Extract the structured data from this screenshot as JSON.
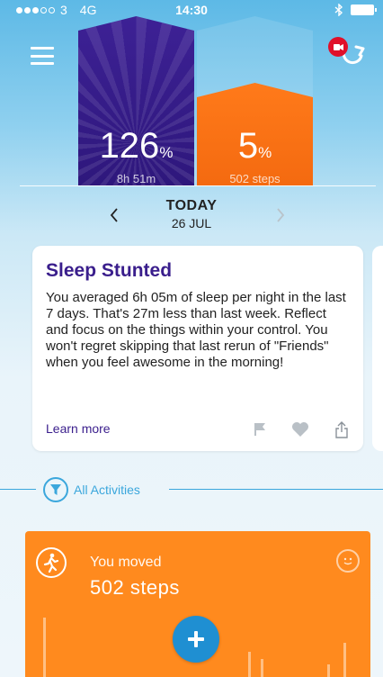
{
  "status_bar": {
    "carrier": "3",
    "network": "4G",
    "time": "14:30"
  },
  "header": {
    "menu_icon": "hamburger-icon",
    "sync_icon": "sync-icon"
  },
  "summary": {
    "sleep": {
      "percent": "126",
      "unit": "%",
      "detail": "8h 51m",
      "progress_percent": 126,
      "color": "#2e177c"
    },
    "steps": {
      "percent": "5",
      "unit": "%",
      "detail": "502 steps",
      "progress_percent": 5,
      "color": "#f46a10"
    }
  },
  "date_nav": {
    "day": "TODAY",
    "date": "26 JUL",
    "prev_icon": "chevron-left-icon",
    "next_icon": "chevron-right-icon"
  },
  "insight_card": {
    "title": "Sleep Stunted",
    "body": "You averaged 6h 05m of sleep per night in the last 7 days. That's 27m less than last week. Reflect and focus on the things within your control. You won't regret skipping that last rerun of \"Friends\" when you feel awesome in the morning!",
    "link": "Learn more",
    "title_color": "#3a1e8c"
  },
  "filter": {
    "label": "All Activities",
    "icon": "funnel-icon",
    "color": "#3ba7dc"
  },
  "activity_card": {
    "title": "You moved",
    "value": "502 steps",
    "icon": "walking-person-icon",
    "color": "#ff8a1e",
    "add_button_color": "#1f8fd2"
  }
}
